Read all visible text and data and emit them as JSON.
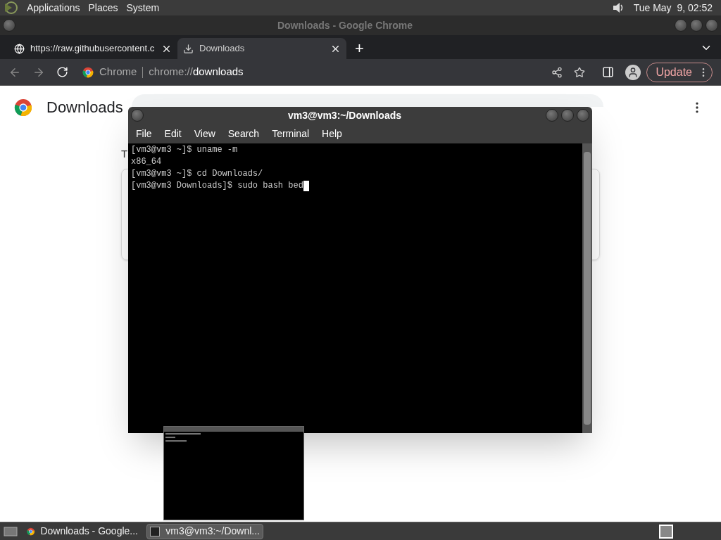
{
  "top_panel": {
    "menus": [
      "Applications",
      "Places",
      "System"
    ],
    "clock": "Tue May  9, 02:52"
  },
  "browser": {
    "title": "Downloads - Google Chrome",
    "tabs": [
      {
        "label": "https://raw.githubusercontent.c",
        "selected": false,
        "kind": "web"
      },
      {
        "label": "Downloads",
        "selected": true,
        "kind": "download"
      }
    ],
    "new_tab": "+",
    "address": {
      "site": "Chrome",
      "url_prefix": "chrome://",
      "url_host": "downloads"
    },
    "update_button": "Update",
    "page": {
      "heading": "Downloads",
      "fragment": "T"
    }
  },
  "terminal": {
    "title": "vm3@vm3:~/Downloads",
    "menu": [
      "File",
      "Edit",
      "View",
      "Search",
      "Terminal",
      "Help"
    ],
    "lines": [
      "[vm3@vm3 ~]$ uname -m",
      "x86_64",
      "[vm3@vm3 ~]$ cd Downloads/",
      "[vm3@vm3 Downloads]$ sudo bash bed"
    ]
  },
  "taskbar": {
    "items": [
      {
        "label": "Downloads - Google...",
        "kind": "chrome",
        "selected": false
      },
      {
        "label": "vm3@vm3:~/Downl...",
        "kind": "terminal",
        "selected": true
      }
    ]
  }
}
